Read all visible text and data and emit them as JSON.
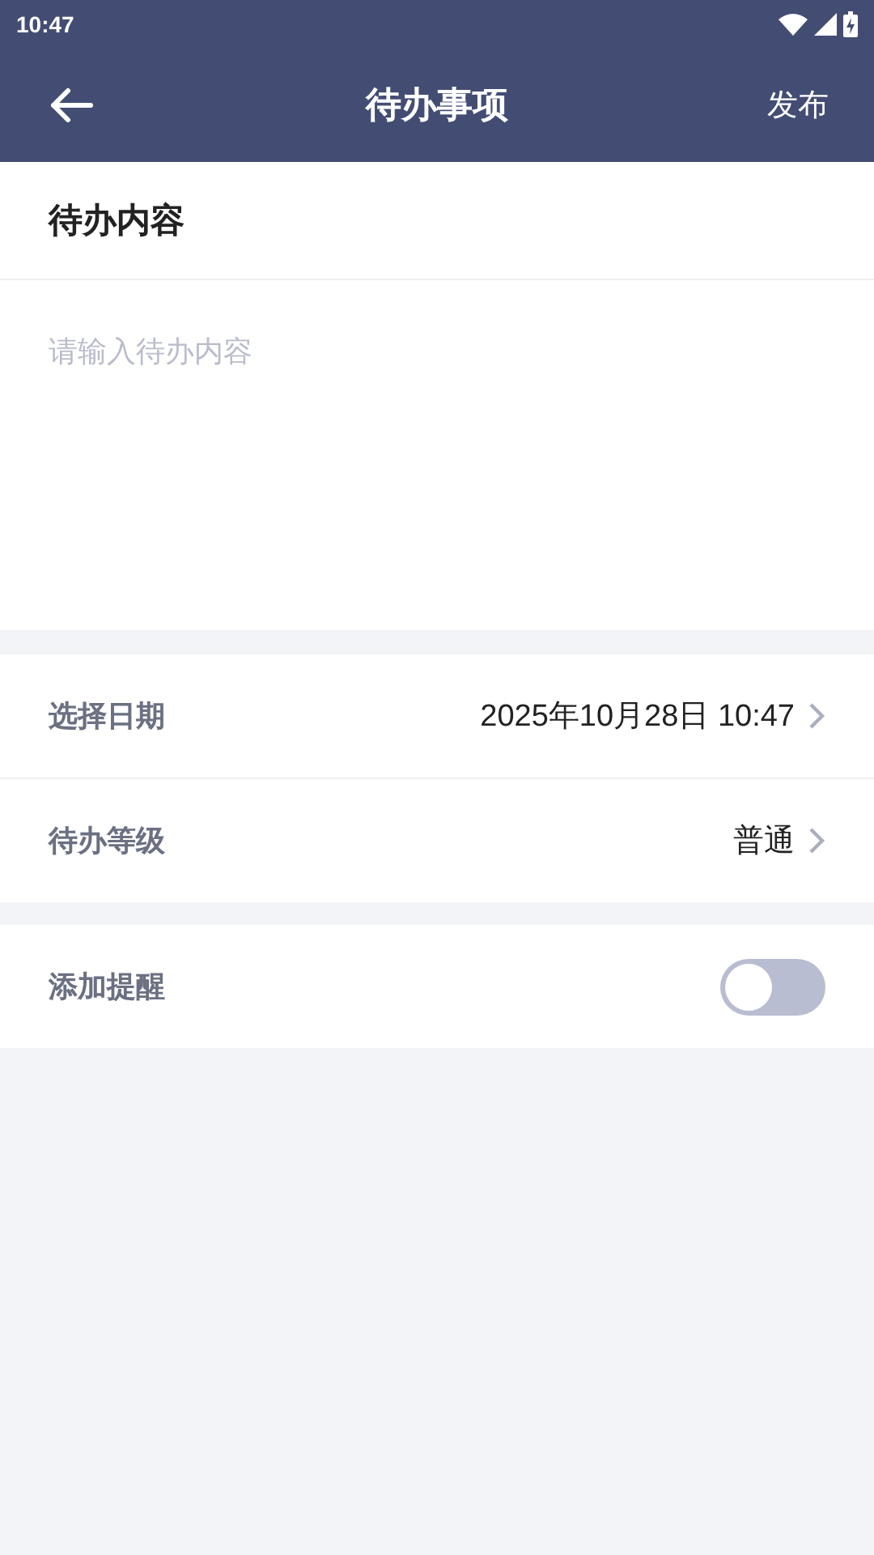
{
  "status_bar": {
    "time": "10:47"
  },
  "header": {
    "title": "待办事项",
    "action": "发布"
  },
  "content": {
    "title": "待办内容",
    "placeholder": "请输入待办内容"
  },
  "settings": [
    {
      "kind": "select",
      "label": "选择日期",
      "value": "2025年10月28日 10:47"
    },
    {
      "kind": "select",
      "label": "待办等级",
      "value": "普通"
    }
  ],
  "reminder": {
    "label": "添加提醒",
    "on": false
  }
}
